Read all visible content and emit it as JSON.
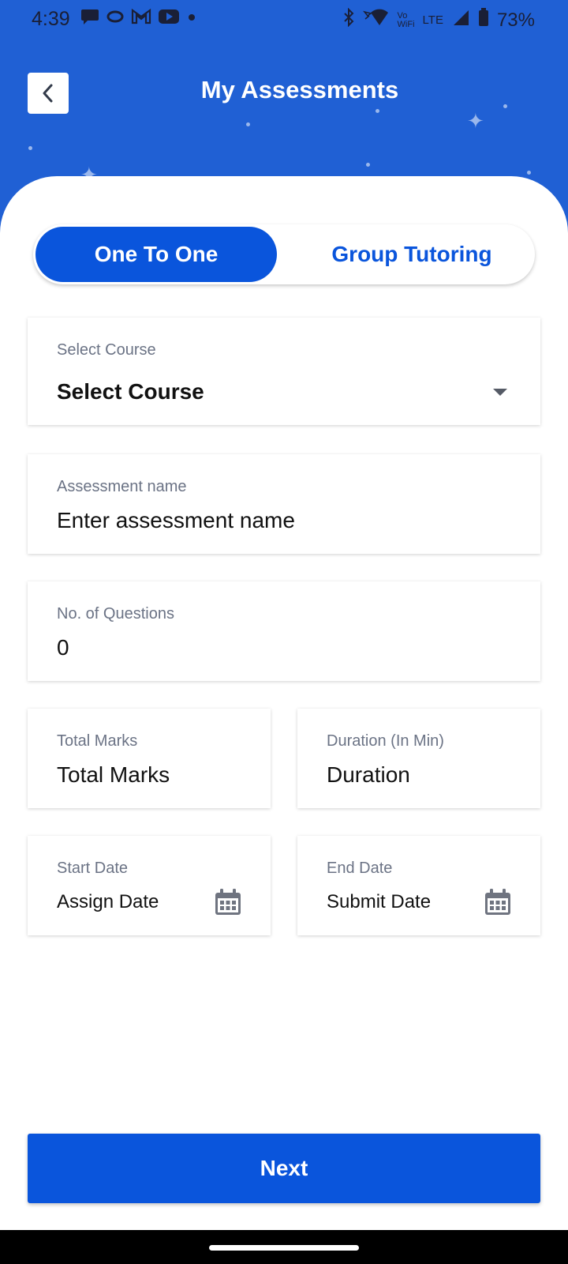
{
  "status_bar": {
    "time": "4:39",
    "battery": "73%",
    "network_small_top": "Vo",
    "network_small_bottom": "WiFi",
    "lte": "LTE"
  },
  "header": {
    "title": "My Assessments",
    "back_icon": "chevron-left-icon"
  },
  "tabs": [
    {
      "label": "One To One",
      "active": true
    },
    {
      "label": "Group Tutoring",
      "active": false
    }
  ],
  "form": {
    "course": {
      "label": "Select Course",
      "value": "Select Course"
    },
    "assessment_name": {
      "label": "Assessment name",
      "value": "Enter assessment name"
    },
    "questions": {
      "label": "No. of Questions",
      "value": "0"
    },
    "total_marks": {
      "label": "Total Marks",
      "value": "Total Marks"
    },
    "duration": {
      "label": "Duration (In Min)",
      "value": "Duration"
    },
    "start_date": {
      "label": "Start Date",
      "value": "Assign Date"
    },
    "end_date": {
      "label": "End Date",
      "value": "Submit Date"
    }
  },
  "actions": {
    "next_label": "Next"
  },
  "colors": {
    "header_bg": "#2060d4",
    "primary": "#0a55dc",
    "label": "#6b7385"
  }
}
